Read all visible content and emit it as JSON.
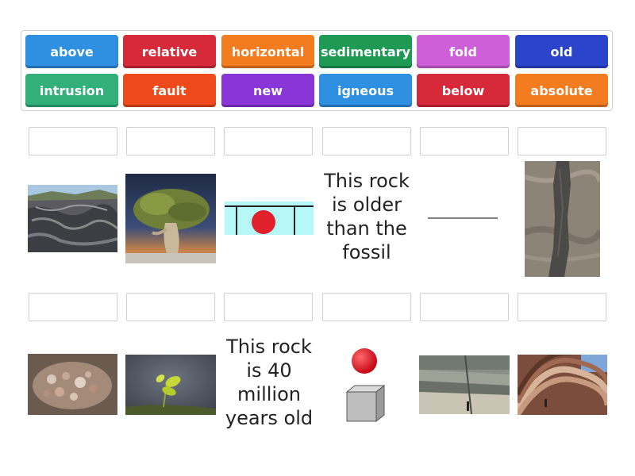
{
  "word_bank": [
    {
      "label": "above",
      "color": "#2f8fe0"
    },
    {
      "label": "relative",
      "color": "#d62a3a"
    },
    {
      "label": "horizontal",
      "color": "#f47c20"
    },
    {
      "label": "sedimentary",
      "color": "#1f9a55"
    },
    {
      "label": "fold",
      "color": "#cf5fd8"
    },
    {
      "label": "old",
      "color": "#2c44c9"
    },
    {
      "label": "intrusion",
      "color": "#33b07a"
    },
    {
      "label": "fault",
      "color": "#ef4a1c"
    },
    {
      "label": "new",
      "color": "#8a35d8"
    },
    {
      "label": "igneous",
      "color": "#2f8fe0"
    },
    {
      "label": "below",
      "color": "#d62a3a"
    },
    {
      "label": "absolute",
      "color": "#f47c20"
    }
  ],
  "row1": {
    "text_card": "This rock is older than the fossil"
  },
  "row2": {
    "text_card": "This rock is 40 million years old"
  }
}
